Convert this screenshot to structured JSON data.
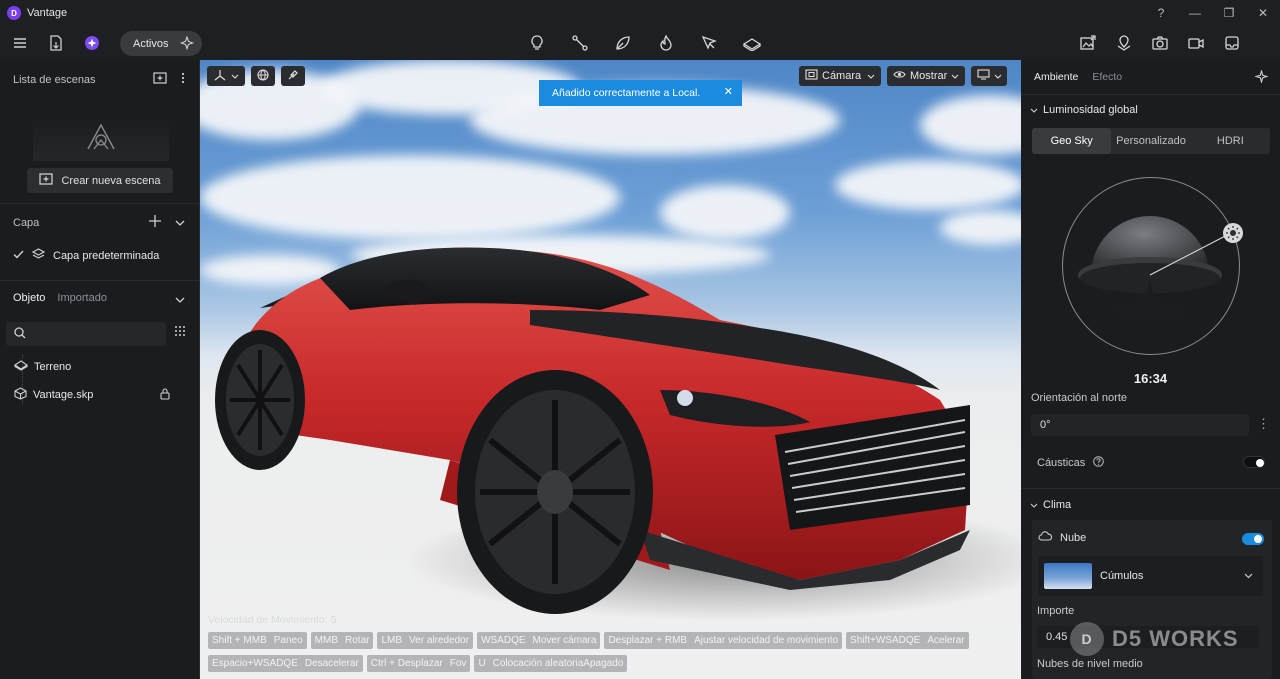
{
  "app": {
    "title": "Vantage",
    "logo_letter": "D"
  },
  "window_controls": [
    "?",
    "—",
    "❐",
    "✕"
  ],
  "toolbar": {
    "activos_label": "Activos"
  },
  "left": {
    "scene_list_title": "Lista de escenas",
    "create_scene_label": "Crear nueva escena",
    "layer_title": "Capa",
    "default_layer": "Capa predeterminada",
    "tab_object": "Objeto",
    "tab_imported": "Importado",
    "tree": [
      {
        "label": "Terreno"
      },
      {
        "label": "Vantage.skp"
      }
    ]
  },
  "viewport": {
    "camera_label": "Cámara",
    "show_label": "Mostrar",
    "toast": "Añadido correctamente a Local.",
    "speed": "Velocidad de Movimiento: 5",
    "hints": [
      {
        "key": "Shift + MMB",
        "action": "Paneo"
      },
      {
        "key": "MMB",
        "action": "Rotar"
      },
      {
        "key": "LMB",
        "action": "Ver alrededor"
      },
      {
        "key": "WSADQE",
        "action": "Mover cámara"
      },
      {
        "key": "Desplazar + RMB",
        "action": "Ajustar velocidad de movimiento"
      },
      {
        "key": "Shift+WSADQE",
        "action": "Acelerar"
      },
      {
        "key": "Espacio+WSADQE",
        "action": "Desacelerar"
      },
      {
        "key": "Ctrl + Desplazar",
        "action": "Fov"
      },
      {
        "key": "U",
        "action": "Colocación aleatoriaApagado"
      }
    ]
  },
  "right": {
    "tab_ambient": "Ambiente",
    "tab_effect": "Efecto",
    "global_light_title": "Luminosidad global",
    "segments": [
      "Geo Sky",
      "Personalizado",
      "HDRI"
    ],
    "time": "16:34",
    "north_label": "Orientación al norte",
    "north_value": "0°",
    "caustics_label": "Cáusticas",
    "caustics_on": false,
    "weather_title": "Clima",
    "cloud_label": "Nube",
    "cloud_on": true,
    "cloud_type": "Cúmulos",
    "amount_label": "Importe",
    "amount_value": "0.45",
    "mid_clouds_label": "Nubes de nivel medio"
  },
  "watermark": {
    "text": "D5 WORKS",
    "logo_letter": "D"
  },
  "colors": {
    "accent": "#1b8be0",
    "car_red": "#c8292a",
    "panel": "#1b1c1f"
  }
}
